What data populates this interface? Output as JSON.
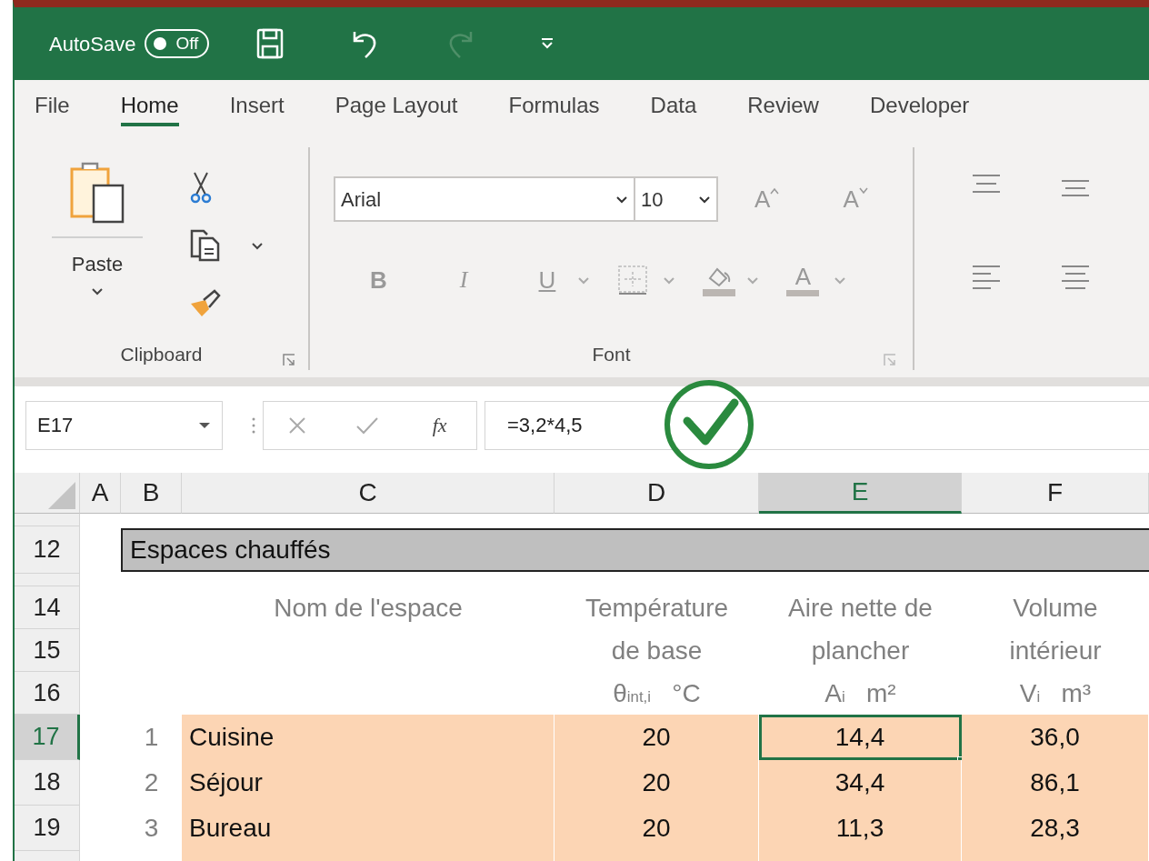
{
  "title_bar": {
    "autosave_label": "AutoSave",
    "autosave_state": "Off",
    "autosave_on": false,
    "redo_disabled": true
  },
  "tabs": [
    {
      "label": "File",
      "selected": false
    },
    {
      "label": "Home",
      "selected": true
    },
    {
      "label": "Insert",
      "selected": false
    },
    {
      "label": "Page Layout",
      "selected": false
    },
    {
      "label": "Formulas",
      "selected": false
    },
    {
      "label": "Data",
      "selected": false
    },
    {
      "label": "Review",
      "selected": false
    },
    {
      "label": "Developer",
      "selected": false
    }
  ],
  "ribbon": {
    "clipboard": {
      "paste_label": "Paste",
      "group_label": "Clipboard"
    },
    "font": {
      "font_name": "Arial",
      "font_size": "10",
      "grow_label": "A",
      "shrink_label": "A",
      "bold_label": "B",
      "italic_label": "I",
      "underline_label": "U",
      "color_label": "A",
      "group_label": "Font"
    }
  },
  "formula_bar": {
    "name_box": "E17",
    "function_label": "fx",
    "formula": "=3,2*4,5"
  },
  "columns": [
    {
      "label": "A",
      "selected": false
    },
    {
      "label": "B",
      "selected": false
    },
    {
      "label": "C",
      "selected": false
    },
    {
      "label": "D",
      "selected": false
    },
    {
      "label": "E",
      "selected": true
    },
    {
      "label": "F",
      "selected": false
    }
  ],
  "rows": [
    {
      "kind": "partial"
    },
    {
      "kind": "title",
      "number": "12",
      "title": "Espaces chauffés"
    },
    {
      "kind": "partial"
    },
    {
      "kind": "header",
      "number": "14",
      "name": "Nom de l'espace",
      "temp": "Température",
      "area": "Aire nette de",
      "volume": "Volume"
    },
    {
      "kind": "header",
      "number": "15",
      "temp": "de base",
      "area": "plancher",
      "volume": "intérieur"
    },
    {
      "kind": "header",
      "number": "16",
      "temp": "θ$_{int,i}$   °C",
      "area": "A$_{i}$   m²",
      "volume": "V$_{i}$   m³"
    },
    {
      "kind": "data",
      "number": "17",
      "selected": true,
      "index": "1",
      "name": "Cuisine",
      "temp": "20",
      "area": "14,4",
      "area_selected": true,
      "volume": "36,0"
    },
    {
      "kind": "data",
      "number": "18",
      "selected": false,
      "index": "2",
      "name": "Séjour",
      "temp": "20",
      "area": "34,4",
      "area_selected": false,
      "volume": "86,1"
    },
    {
      "kind": "data",
      "number": "19",
      "selected": false,
      "index": "3",
      "name": "Bureau",
      "temp": "20",
      "area": "11,3",
      "area_selected": false,
      "volume": "28,3"
    },
    {
      "kind": "partial-data"
    }
  ]
}
